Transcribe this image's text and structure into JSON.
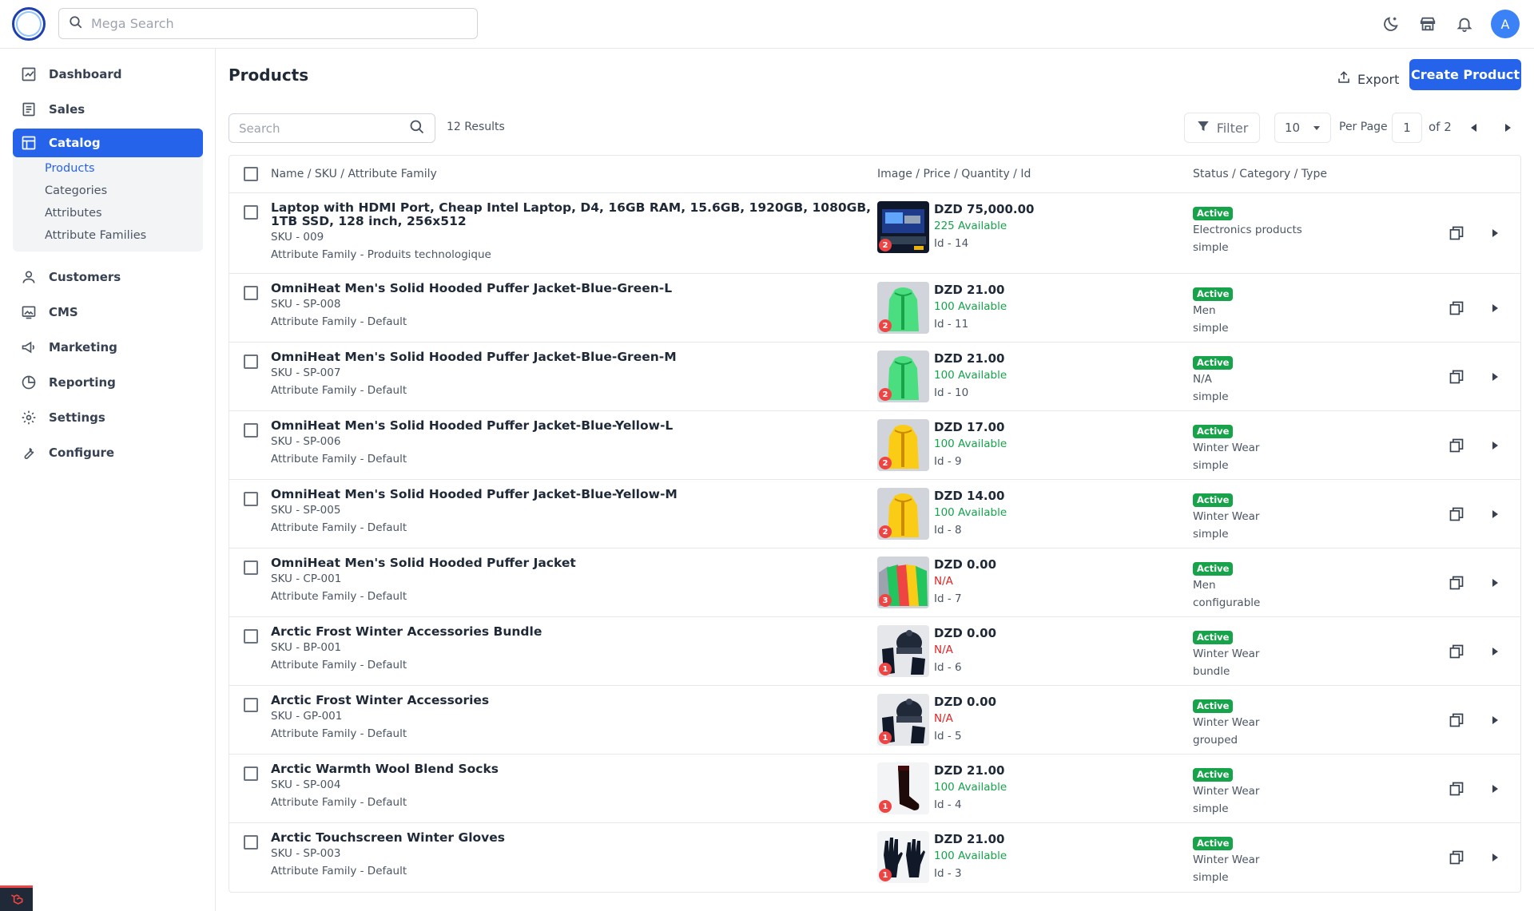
{
  "header": {
    "search_placeholder": "Mega Search",
    "avatar_initial": "A"
  },
  "sidebar": {
    "items": [
      {
        "label": "Dashboard",
        "icon": "dashboard-icon"
      },
      {
        "label": "Sales",
        "icon": "sales-icon"
      },
      {
        "label": "Catalog",
        "icon": "catalog-icon"
      },
      {
        "label": "Customers",
        "icon": "customers-icon"
      },
      {
        "label": "CMS",
        "icon": "cms-icon"
      },
      {
        "label": "Marketing",
        "icon": "marketing-icon"
      },
      {
        "label": "Reporting",
        "icon": "reporting-icon"
      },
      {
        "label": "Settings",
        "icon": "settings-icon"
      },
      {
        "label": "Configure",
        "icon": "configure-icon"
      }
    ],
    "catalog_sub": [
      "Products",
      "Categories",
      "Attributes",
      "Attribute Families"
    ]
  },
  "page": {
    "title": "Products",
    "export_label": "Export",
    "create_label": "Create Product"
  },
  "toolbar": {
    "search_placeholder": "Search",
    "results": "12 Results",
    "filter_label": "Filter",
    "per_page_value": "10",
    "per_page_label": "Per Page",
    "page_number": "1",
    "page_of": "of 2"
  },
  "table": {
    "headers": [
      "Name / SKU / Attribute Family",
      "Image / Price / Quantity / Id",
      "Status / Category / Type"
    ],
    "rows": [
      {
        "name": "Laptop with HDMI Port, Cheap Intel Laptop, D4, 16GB RAM, 15.6GB, 1920GB, 1080GB, 1TB SSD, 128 inch, 256x512",
        "sku": "SKU - 009",
        "family": "Attribute Family - Produits technologique",
        "images": "2",
        "price": "DZD 75,000.00",
        "qty": "225 Available",
        "qty_ok": true,
        "id": "Id - 14",
        "status": "Active",
        "category": "Electronics products",
        "type": "simple",
        "thumb": "laptop"
      },
      {
        "name": "OmniHeat Men's Solid Hooded Puffer Jacket-Blue-Green-L",
        "sku": "SKU - SP-008",
        "family": "Attribute Family - Default",
        "images": "2",
        "price": "DZD 21.00",
        "qty": "100 Available",
        "qty_ok": true,
        "id": "Id - 11",
        "status": "Active",
        "category": "Men",
        "type": "simple",
        "thumb": "green"
      },
      {
        "name": "OmniHeat Men's Solid Hooded Puffer Jacket-Blue-Green-M",
        "sku": "SKU - SP-007",
        "family": "Attribute Family - Default",
        "images": "2",
        "price": "DZD 21.00",
        "qty": "100 Available",
        "qty_ok": true,
        "id": "Id - 10",
        "status": "Active",
        "category": "N/A",
        "type": "simple",
        "thumb": "green"
      },
      {
        "name": "OmniHeat Men's Solid Hooded Puffer Jacket-Blue-Yellow-L",
        "sku": "SKU - SP-006",
        "family": "Attribute Family - Default",
        "images": "2",
        "price": "DZD 17.00",
        "qty": "100 Available",
        "qty_ok": true,
        "id": "Id - 9",
        "status": "Active",
        "category": "Winter Wear",
        "type": "simple",
        "thumb": "yellow"
      },
      {
        "name": "OmniHeat Men's Solid Hooded Puffer Jacket-Blue-Yellow-M",
        "sku": "SKU - SP-005",
        "family": "Attribute Family - Default",
        "images": "2",
        "price": "DZD 14.00",
        "qty": "100 Available",
        "qty_ok": true,
        "id": "Id - 8",
        "status": "Active",
        "category": "Winter Wear",
        "type": "simple",
        "thumb": "yellow"
      },
      {
        "name": "OmniHeat Men's Solid Hooded Puffer Jacket",
        "sku": "SKU - CP-001",
        "family": "Attribute Family - Default",
        "images": "3",
        "price": "DZD 0.00",
        "qty": "N/A",
        "qty_ok": false,
        "id": "Id - 7",
        "status": "Active",
        "category": "Men",
        "type": "configurable",
        "thumb": "multi"
      },
      {
        "name": "Arctic Frost Winter Accessories Bundle",
        "sku": "SKU - BP-001",
        "family": "Attribute Family - Default",
        "images": "1",
        "price": "DZD 0.00",
        "qty": "N/A",
        "qty_ok": false,
        "id": "Id - 6",
        "status": "Active",
        "category": "Winter Wear",
        "type": "bundle",
        "thumb": "accessories"
      },
      {
        "name": "Arctic Frost Winter Accessories",
        "sku": "SKU - GP-001",
        "family": "Attribute Family - Default",
        "images": "1",
        "price": "DZD 0.00",
        "qty": "N/A",
        "qty_ok": false,
        "id": "Id - 5",
        "status": "Active",
        "category": "Winter Wear",
        "type": "grouped",
        "thumb": "accessories"
      },
      {
        "name": "Arctic Warmth Wool Blend Socks",
        "sku": "SKU - SP-004",
        "family": "Attribute Family - Default",
        "images": "1",
        "price": "DZD 21.00",
        "qty": "100 Available",
        "qty_ok": true,
        "id": "Id - 4",
        "status": "Active",
        "category": "Winter Wear",
        "type": "simple",
        "thumb": "socks"
      },
      {
        "name": "Arctic Touchscreen Winter Gloves",
        "sku": "SKU - SP-003",
        "family": "Attribute Family - Default",
        "images": "1",
        "price": "DZD 21.00",
        "qty": "100 Available",
        "qty_ok": true,
        "id": "Id - 3",
        "status": "Active",
        "category": "Winter Wear",
        "type": "simple",
        "thumb": "gloves"
      }
    ]
  },
  "colors": {
    "primary": "#2563eb",
    "active_badge": "#16a34a",
    "available": "#16a34a",
    "unavailable": "#dc2626",
    "image_count_badge": "#ef4444"
  }
}
